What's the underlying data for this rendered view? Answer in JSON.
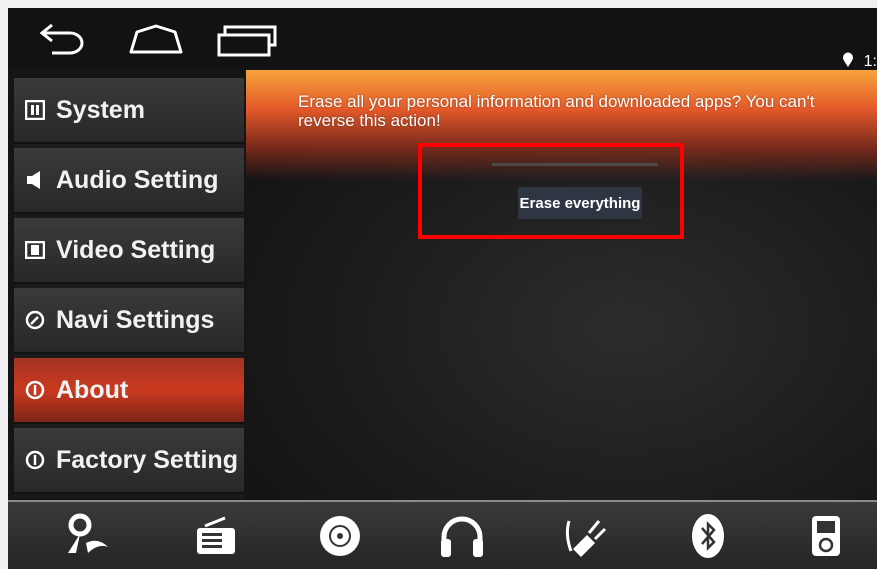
{
  "status": {
    "location_icon": "location-pin-icon",
    "clock": "1:"
  },
  "nav": {
    "icons": [
      "back-icon",
      "home-icon",
      "recent-apps-icon"
    ]
  },
  "sidebar": {
    "items": [
      {
        "label": "System",
        "icon": "system-icon",
        "active": false
      },
      {
        "label": "Audio Setting",
        "icon": "speaker-icon",
        "active": false
      },
      {
        "label": "Video Setting",
        "icon": "film-icon",
        "active": false
      },
      {
        "label": "Navi Settings",
        "icon": "compass-icon",
        "active": false
      },
      {
        "label": "About",
        "icon": "info-icon",
        "active": true
      },
      {
        "label": "Factory Setting",
        "icon": "info-icon",
        "active": false
      }
    ]
  },
  "main": {
    "message": "Erase all your personal information and downloaded apps? You can't reverse this action!",
    "erase_button": "Erase everything"
  },
  "dock": {
    "icons": [
      "navigation-icon",
      "radio-icon",
      "disc-icon",
      "headphones-icon",
      "aux-plug-icon",
      "bluetooth-icon",
      "ipod-icon"
    ]
  },
  "colors": {
    "accent": "#d2401f",
    "highlight": "#ff0000",
    "banner": "#f7a43c"
  }
}
